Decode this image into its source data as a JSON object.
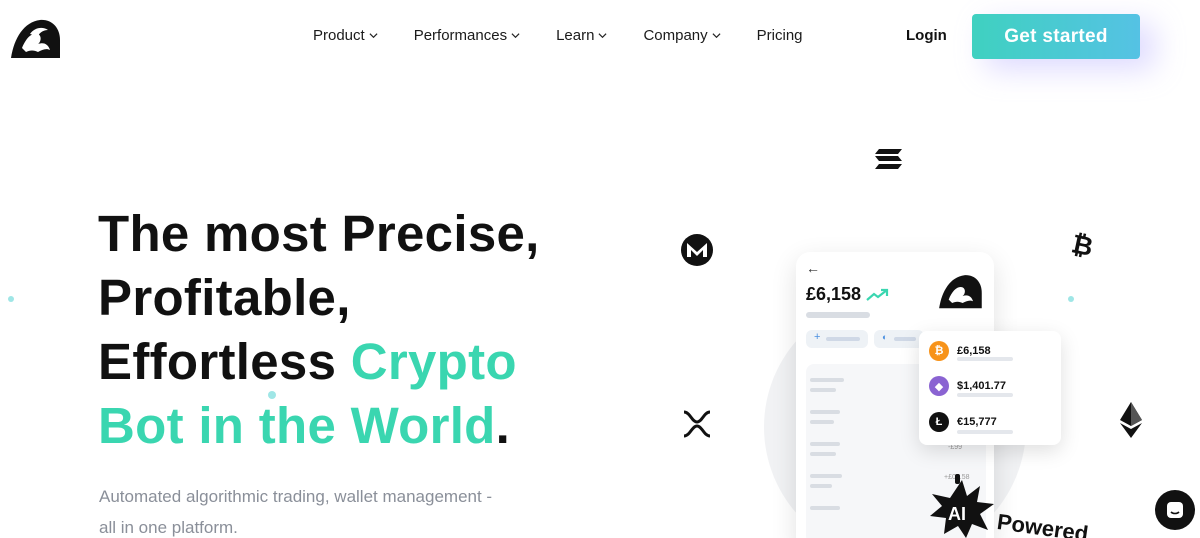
{
  "header": {
    "nav": [
      {
        "label": "Product",
        "has_dropdown": true
      },
      {
        "label": "Performances",
        "has_dropdown": true
      },
      {
        "label": "Learn",
        "has_dropdown": true
      },
      {
        "label": "Company",
        "has_dropdown": true
      },
      {
        "label": "Pricing",
        "has_dropdown": false
      }
    ],
    "login_label": "Login",
    "cta_label": "Get started"
  },
  "hero": {
    "title_line1": "The most Precise,",
    "title_line2": "Profitable,",
    "title_line3_plain": "Effortless ",
    "title_line3_accent": "Crypto",
    "title_line4_accent": "Bot in the World",
    "title_line4_period": ".",
    "subtitle": "Automated algorithmic trading, wallet management - all in one platform."
  },
  "illustration": {
    "phone_balance": "£6,158",
    "phone_small_1": "-£99",
    "phone_small_2": "+£02.58",
    "coins": [
      {
        "icon": "bitcoin-icon",
        "value": "£6,158",
        "color": "#f7931a"
      },
      {
        "icon": "ethereum-icon",
        "value": "$1,401.77",
        "color": "#8a63d2"
      },
      {
        "icon": "litecoin-icon",
        "value": "€15,777",
        "color": "#111111"
      }
    ],
    "ai_badge": "AI",
    "ai_text": "Powered"
  },
  "colors": {
    "accent": "#3ad6b0",
    "cta_start": "#3fd1c0",
    "cta_end": "#55c2e4"
  }
}
